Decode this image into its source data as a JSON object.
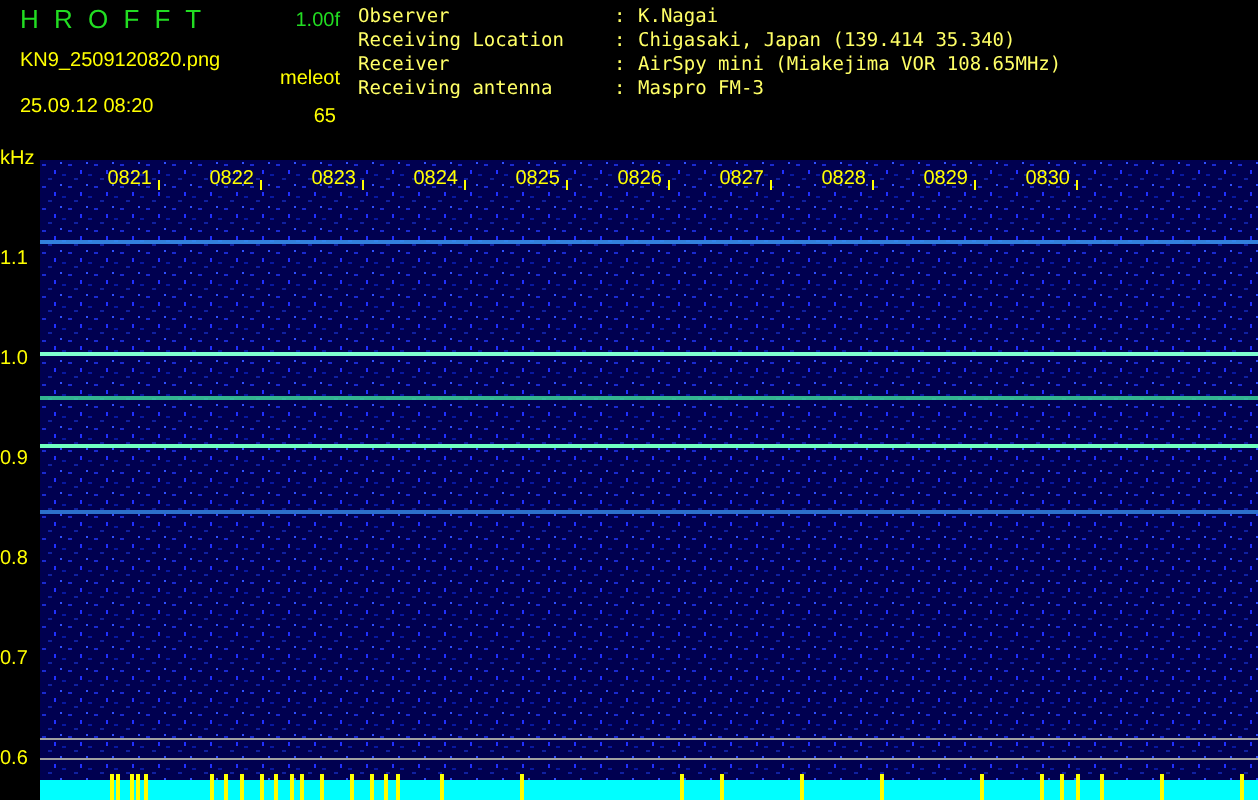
{
  "header": {
    "title": "H R O F F T",
    "version": "1.00f",
    "filename": "KN9_2509120820.png",
    "datetime": "25.09.12 08:20",
    "mode": "meleot",
    "count": "65"
  },
  "station": [
    {
      "label": "Observer",
      "separator": ":",
      "value": "K.Nagai"
    },
    {
      "label": "Receiving Location",
      "separator": ":",
      "value": "Chigasaki, Japan (139.414 35.340)"
    },
    {
      "label": "Receiver",
      "separator": ":",
      "value": "AirSpy mini (Miakejima VOR 108.65MHz)"
    },
    {
      "label": "Receiving antenna",
      "separator": ":",
      "value": "Maspro FM-3"
    }
  ],
  "frequency_axis": {
    "unit": "kHz",
    "labels": [
      "1.1",
      "1.0",
      "0.9",
      "0.8",
      "0.7",
      "0.6"
    ]
  },
  "time_axis": {
    "labels": [
      "0821",
      "0822",
      "0823",
      "0824",
      "0825",
      "0826",
      "0827",
      "0828",
      "0829",
      "0830"
    ]
  }
}
